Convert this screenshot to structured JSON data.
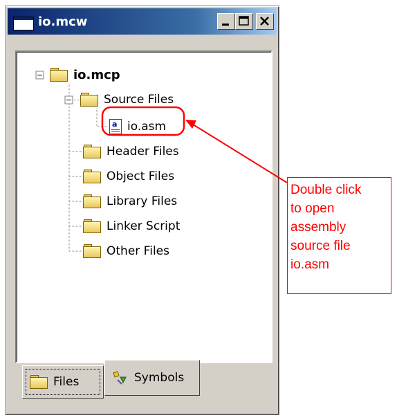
{
  "window": {
    "title": "io.mcw",
    "buttons": [
      "minimize",
      "maximize",
      "close"
    ]
  },
  "tree": {
    "root": "io.mcp",
    "items": [
      {
        "label": "Source Files",
        "children": [
          "io.asm"
        ]
      },
      {
        "label": "Header Files"
      },
      {
        "label": "Object Files"
      },
      {
        "label": "Library Files"
      },
      {
        "label": "Linker Script"
      },
      {
        "label": "Other Files"
      }
    ]
  },
  "tabs": [
    {
      "label": "Files",
      "icon": "folder-icon",
      "active": true
    },
    {
      "label": "Symbols",
      "icon": "symbols-icon",
      "active": false
    }
  ],
  "annotation": {
    "lines": [
      "Double click",
      "to open",
      "assembly",
      "source file",
      "io.asm"
    ],
    "color": "#ff0000"
  },
  "colors": {
    "titlebar": "#0a246a",
    "window_face": "#d4d0c8",
    "annotation": "#ff0000"
  }
}
